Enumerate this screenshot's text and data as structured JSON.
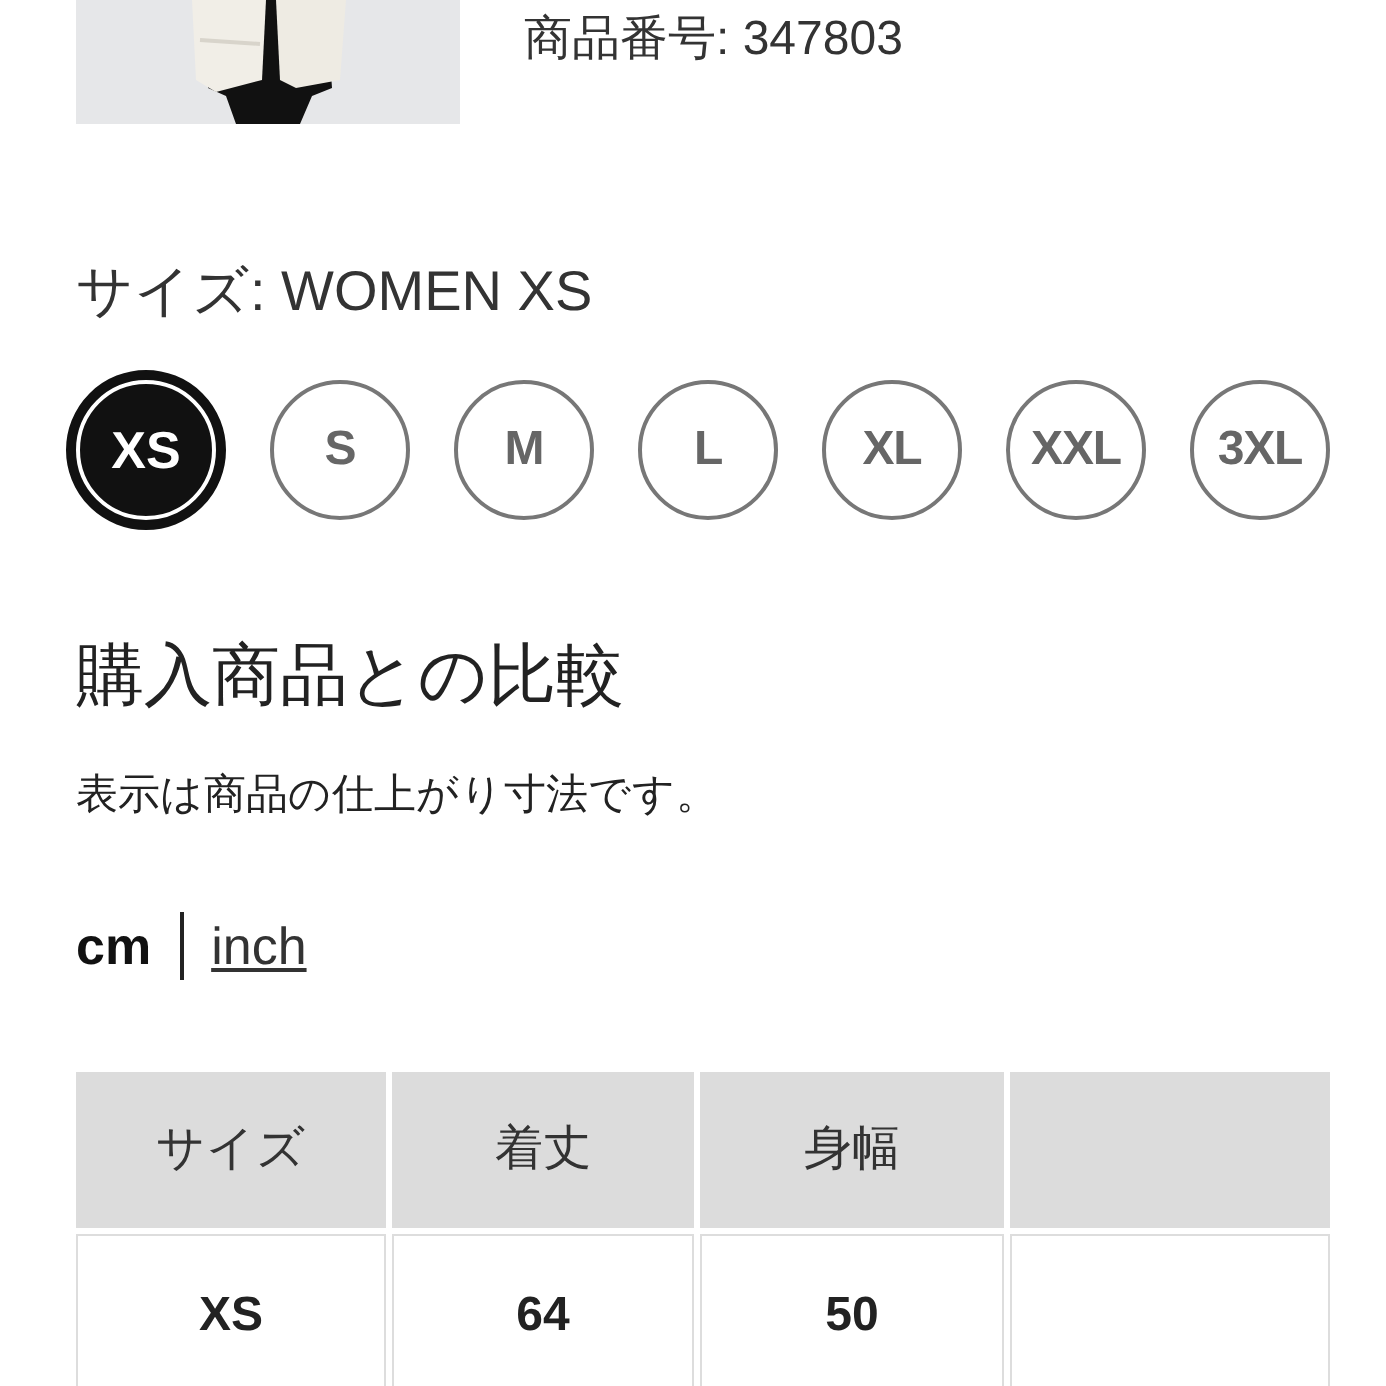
{
  "product": {
    "number": "商品番号: 347803"
  },
  "size_label": "サイズ: WOMEN XS",
  "sizes": [
    {
      "label": "XS",
      "selected": true
    },
    {
      "label": "S",
      "selected": false
    },
    {
      "label": "M",
      "selected": false
    },
    {
      "label": "L",
      "selected": false
    },
    {
      "label": "XL",
      "selected": false
    },
    {
      "label": "XXL",
      "selected": false
    },
    {
      "label": "3XL",
      "selected": false
    }
  ],
  "comparison": {
    "title": "購入商品との比較",
    "note": "表示は商品の仕上がり寸法です。"
  },
  "units": [
    {
      "label": "cm",
      "selected": true
    },
    {
      "label": "inch",
      "selected": false
    }
  ],
  "table": {
    "columns": [
      "サイズ",
      "着丈",
      "身幅",
      ""
    ],
    "rows": [
      [
        "XS",
        "64",
        "50",
        ""
      ]
    ]
  }
}
